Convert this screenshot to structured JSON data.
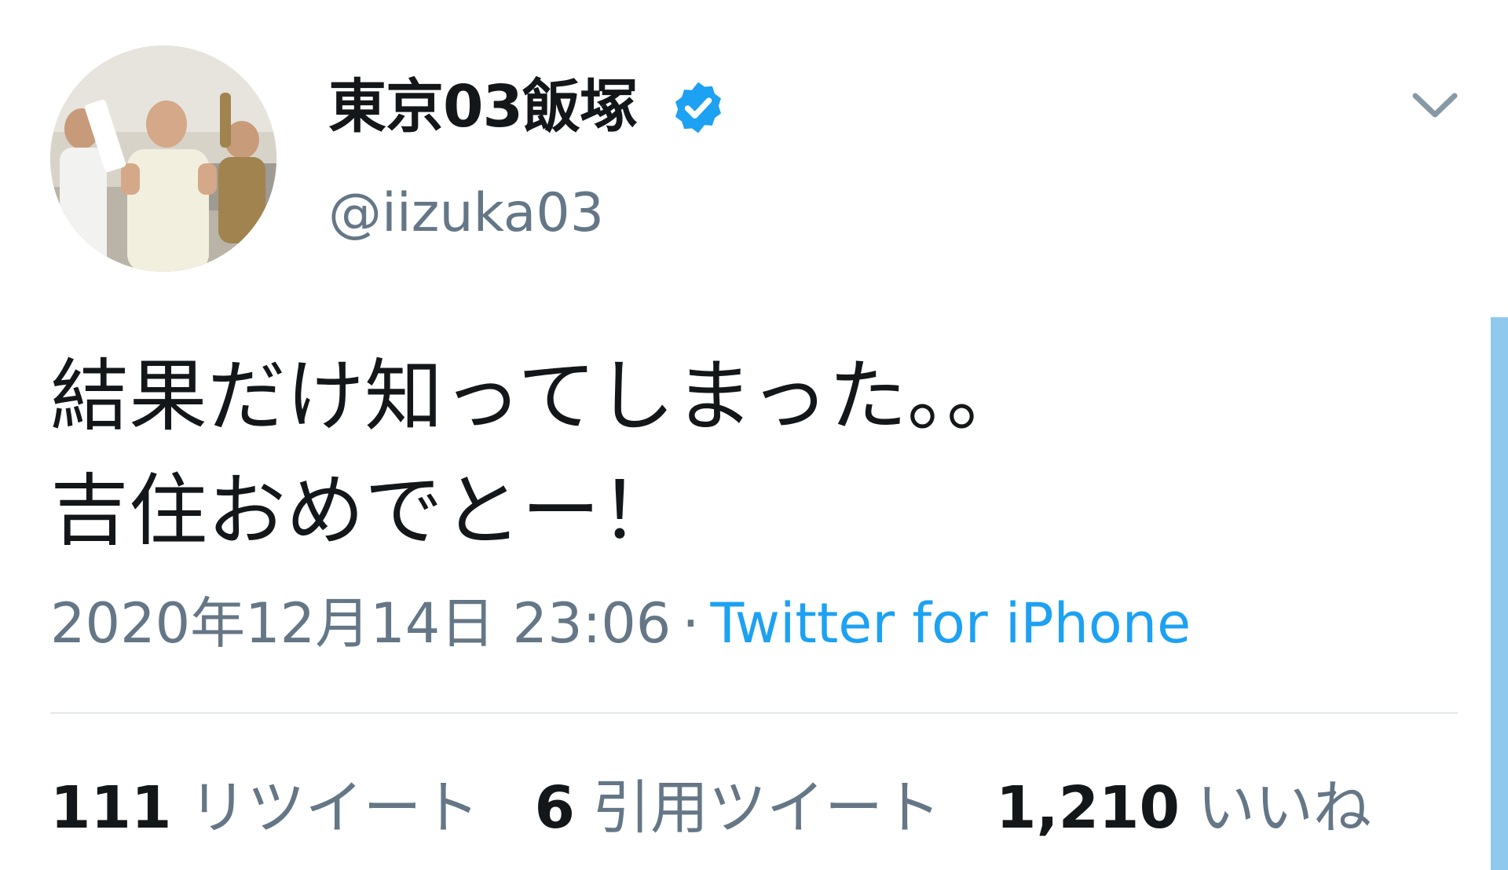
{
  "user": {
    "display_name": "東京03飯塚",
    "handle": "@iizuka03",
    "verified": true
  },
  "tweet": {
    "lines": [
      "結果だけ知ってしまった。。",
      "吉住おめでとー！"
    ]
  },
  "meta": {
    "datetime": "2020年12月14日 23:06",
    "separator": "·",
    "source": "Twitter for iPhone"
  },
  "stats": {
    "retweets": {
      "count": "111",
      "label": "リツイート"
    },
    "quotes": {
      "count": "6",
      "label": "引用ツイート"
    },
    "likes": {
      "count": "1,210",
      "label": "いいね"
    }
  },
  "colors": {
    "text": "#14171a",
    "secondary": "#657786",
    "accent": "#1da1f2",
    "divider": "#e1e8ed",
    "scrollbar": "#8fc9ee"
  },
  "icons": {
    "verified": "verified-badge-icon",
    "menu": "chevron-down-icon"
  }
}
